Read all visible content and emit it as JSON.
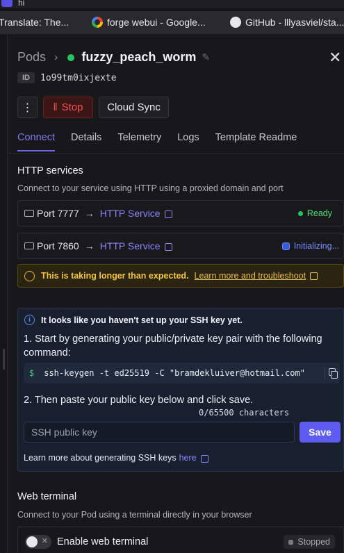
{
  "browser": {
    "tab_title": "hi",
    "bookmarks": [
      {
        "label": "Translate: The..."
      },
      {
        "label": "forge webui - Google...",
        "icon": "google-icon"
      },
      {
        "label": "GitHub - lllyasviel/sta...",
        "icon": "github-icon"
      }
    ]
  },
  "header": {
    "breadcrumb_root": "Pods",
    "pod_name": "fuzzy_peach_worm",
    "status_color": "#22c55e"
  },
  "pod": {
    "id_label": "ID",
    "id_value": "1o99tm0ixjexte"
  },
  "actions": {
    "stop_label": "Stop",
    "cloud_sync_label": "Cloud Sync"
  },
  "tabs": [
    {
      "label": "Connect",
      "active": true
    },
    {
      "label": "Details"
    },
    {
      "label": "Telemetry"
    },
    {
      "label": "Logs"
    },
    {
      "label": "Template Readme"
    }
  ],
  "http": {
    "title": "HTTP services",
    "subtitle": "Connect to your service using HTTP using a proxied domain and port",
    "services": [
      {
        "port": "Port 7777",
        "link": "HTTP Service",
        "status": "Ready"
      },
      {
        "port": "Port 7860",
        "link": "HTTP Service",
        "status": "Initializing..."
      }
    ]
  },
  "warning": {
    "text": "This is taking longer than expected.",
    "link": "Learn more and troubleshoot"
  },
  "ssh": {
    "notice": "It looks like you haven't set up your SSH key yet.",
    "step1": "1. Start by generating your public/private key pair with the following command:",
    "prompt": "$",
    "command": "ssh-keygen -t ed25519 -C \"bramdekluiver@hotmail.com\"",
    "step2": "2. Then paste your public key below and click save.",
    "counter": "0/65500 characters",
    "placeholder": "SSH public key",
    "save_label": "Save",
    "learn_text": "Learn more about generating SSH keys",
    "learn_link": "here"
  },
  "web_terminal": {
    "title": "Web terminal",
    "subtitle": "Connect to your Pod using a terminal directly in your browser",
    "toggle_label": "Enable web terminal",
    "status": "Stopped"
  },
  "colors": {
    "accent": "#6a66e8",
    "ready": "#22c55e",
    "stop": "#ef5350",
    "warning": "#f5c53d"
  }
}
